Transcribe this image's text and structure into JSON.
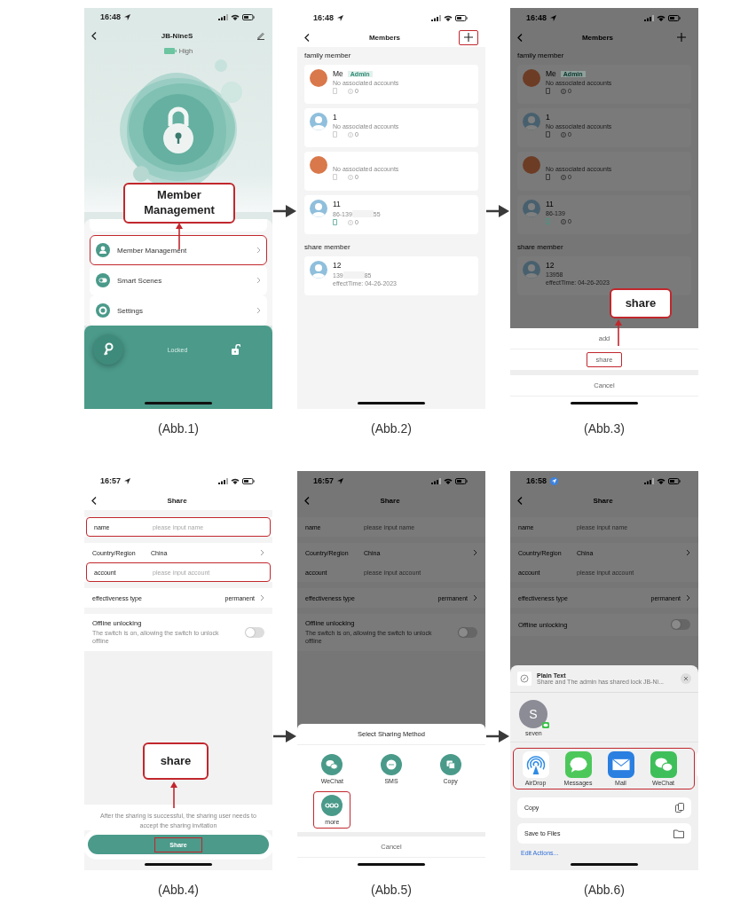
{
  "figures": [
    {
      "kind": "lock",
      "caption": "(Abb.1)",
      "time": "16:48",
      "location_badge": false,
      "dimmed": false,
      "title": "JB-NineS",
      "battery_text": "High",
      "callout": "Member Management",
      "lock_state": "Locked",
      "menu": [
        {
          "label": "Member Management",
          "highlighted": true
        },
        {
          "label": "Smart Scenes",
          "highlighted": false
        },
        {
          "label": "Settings",
          "highlighted": false
        }
      ]
    },
    {
      "kind": "members",
      "caption": "(Abb.2)",
      "time": "16:48",
      "location_badge": false,
      "dimmed": false,
      "title": "Members",
      "add_highlighted": true,
      "sections": [
        {
          "heading": "family member",
          "members": [
            {
              "name": "Me",
              "badge": "Admin",
              "has_photo": true,
              "account": "No associated accounts",
              "phone_linked": false,
              "fingerprints": "0"
            },
            {
              "name": "1",
              "has_photo": false,
              "account": "No associated accounts",
              "phone_linked": false,
              "fingerprints": "0"
            },
            {
              "has_photo": true,
              "account": "No associated accounts",
              "phone_linked": false,
              "fingerprints": "0"
            },
            {
              "name": "11",
              "has_photo": false,
              "account": "86-139",
              "account_end": "55",
              "phone_linked": true,
              "fingerprints": "0"
            }
          ]
        },
        {
          "heading": "share member",
          "members": [
            {
              "name": "12",
              "has_photo": false,
              "account": "139",
              "account_end": "85",
              "effect_time": "effectTime: 04-26-2023"
            }
          ]
        }
      ]
    },
    {
      "kind": "members",
      "caption": "(Abb.3)",
      "time": "16:48",
      "location_badge": false,
      "dimmed": true,
      "title": "Members",
      "add_highlighted": false,
      "callout": "share",
      "sections": [
        {
          "heading": "family member",
          "members": [
            {
              "name": "Me",
              "badge": "Admin",
              "has_photo": true,
              "account": "No associated accounts",
              "phone_linked": false,
              "fingerprints": "0"
            },
            {
              "name": "1",
              "has_photo": false,
              "account": "No associated accounts",
              "phone_linked": false,
              "fingerprints": "0"
            },
            {
              "has_photo": true,
              "account": "No associated accounts",
              "phone_linked": false,
              "fingerprints": "0"
            },
            {
              "name": "11",
              "has_photo": false,
              "account": "86-139",
              "phone_linked": true,
              "fingerprints": "0"
            }
          ]
        },
        {
          "heading": "share member",
          "members": [
            {
              "name": "12",
              "has_photo": false,
              "account": "13958",
              "effect_time": "effectTime: 04-26-2023"
            }
          ]
        }
      ],
      "sheet": {
        "kind": "actions",
        "options": [
          {
            "label": "add",
            "highlighted": false
          },
          {
            "label": "share",
            "highlighted": true
          }
        ],
        "cancel": "Cancel"
      }
    },
    {
      "kind": "share_form",
      "caption": "(Abb.4)",
      "time": "16:57",
      "location_badge": false,
      "dimmed": false,
      "title": "Share",
      "callout": "share",
      "groups": [
        {
          "rows": [
            {
              "kind": "input",
              "label": "name",
              "placeholder": "please input name",
              "highlighted": true
            }
          ]
        },
        {
          "rows": [
            {
              "kind": "select",
              "label": "Country/Region",
              "value": "China"
            },
            {
              "kind": "input",
              "label": "account",
              "placeholder": "please input account",
              "highlighted": true
            }
          ]
        },
        {
          "rows": [
            {
              "kind": "select",
              "label": "effectiveness type",
              "value": "permanent"
            }
          ]
        },
        {
          "rows": [
            {
              "kind": "toggle",
              "label": "Offline unlocking",
              "description": "The switch is on, allowing the switch to unlock offline",
              "on": false
            }
          ]
        }
      ],
      "note": "After the sharing is successful, the sharing user needs to accept the sharing invitation",
      "button": {
        "label": "Share",
        "highlighted": true
      }
    },
    {
      "kind": "share_form",
      "caption": "(Abb.5)",
      "time": "16:57",
      "location_badge": false,
      "dimmed": true,
      "title": "Share",
      "groups": [
        {
          "rows": [
            {
              "kind": "input",
              "label": "name",
              "placeholder": "please input name",
              "highlighted": false
            }
          ]
        },
        {
          "rows": [
            {
              "kind": "select",
              "label": "Country/Region",
              "value": "China"
            },
            {
              "kind": "input",
              "label": "account",
              "placeholder": "please input account",
              "highlighted": false
            }
          ]
        },
        {
          "rows": [
            {
              "kind": "select",
              "label": "effectiveness type",
              "value": "permanent"
            }
          ]
        },
        {
          "rows": [
            {
              "kind": "toggle",
              "label": "Offline unlocking",
              "description": "The switch is on, allowing the switch to unlock offline",
              "on": false
            }
          ]
        }
      ],
      "sheet": {
        "kind": "methods",
        "title": "Select Sharing Method",
        "cancel": "Cancel",
        "methods": [
          {
            "label": "WeChat",
            "highlighted": false
          },
          {
            "label": "SMS",
            "highlighted": false
          },
          {
            "label": "Copy",
            "highlighted": false
          },
          {
            "label": "more",
            "highlighted": true
          }
        ]
      }
    },
    {
      "kind": "share_form",
      "caption": "(Abb.6)",
      "time": "16:58",
      "location_badge": true,
      "dimmed": true,
      "title": "Share",
      "groups": [
        {
          "rows": [
            {
              "kind": "input",
              "label": "name",
              "placeholder": "please input name",
              "highlighted": false
            }
          ]
        },
        {
          "rows": [
            {
              "kind": "select",
              "label": "Country/Region",
              "value": "China"
            },
            {
              "kind": "input",
              "label": "account",
              "placeholder": "please input account",
              "highlighted": false
            }
          ]
        },
        {
          "rows": [
            {
              "kind": "select",
              "label": "effectiveness type",
              "value": "permanent"
            }
          ]
        },
        {
          "rows": [
            {
              "kind": "toggle",
              "label": "Offline unlocking",
              "on": false
            }
          ]
        }
      ],
      "sheet": {
        "kind": "ios_share",
        "preview_title": "Plain Text",
        "preview_text": "Share and  The admin has shared lock JB-Ni...",
        "contact": {
          "initial": "S",
          "name": "seven"
        },
        "apps_highlighted": true,
        "apps": [
          {
            "label": "AirDrop"
          },
          {
            "label": "Messages"
          },
          {
            "label": "Mail"
          },
          {
            "label": "WeChat"
          }
        ],
        "actions": [
          {
            "label": "Copy"
          },
          {
            "label": "Save to Files"
          }
        ],
        "edit_actions": "Edit Actions..."
      }
    }
  ]
}
